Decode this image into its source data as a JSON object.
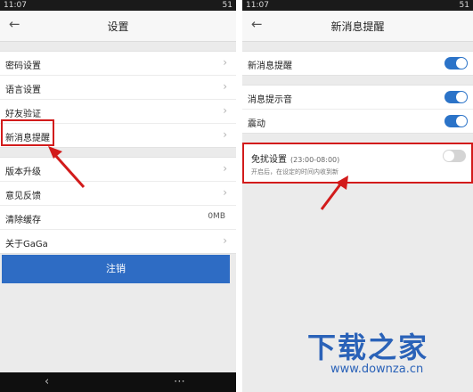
{
  "left": {
    "status": {
      "time": "11:07",
      "signal": "51"
    },
    "title": "设置",
    "items": [
      {
        "label": "密码设置"
      },
      {
        "label": "语言设置"
      },
      {
        "label": "好友验证"
      },
      {
        "label": "新消息提醒"
      },
      {
        "label": "版本升级"
      },
      {
        "label": "意见反馈"
      },
      {
        "label": "清除缓存",
        "value": "0MB"
      },
      {
        "label": "关于GaGa"
      }
    ],
    "logout_label": "注销"
  },
  "right": {
    "status": {
      "time": "11:07",
      "signal": "51"
    },
    "title": "新消息提醒",
    "new_msg_label": "新消息提醒",
    "sound_label": "消息提示音",
    "vibrate_label": "震动",
    "dnd_label": "免扰设置",
    "dnd_time": "(23:00-08:00)",
    "dnd_desc": "开启后，在设定的时间内收到新"
  },
  "watermark": {
    "title": "下载之家",
    "url": "www.downza.cn"
  },
  "colors": {
    "accent": "#2e6cc4",
    "highlight": "#d21b1b"
  },
  "icons": [
    "back-arrow-icon",
    "chevron-right-icon",
    "toggle-switch",
    "red-arrow-icon"
  ]
}
